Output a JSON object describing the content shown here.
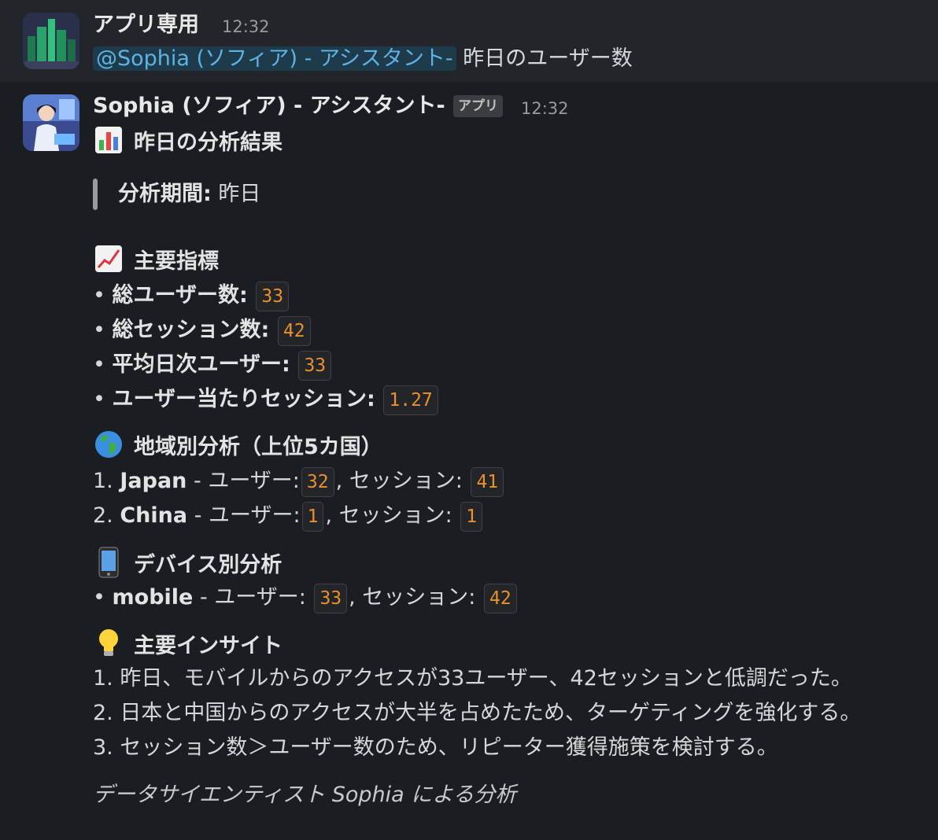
{
  "message1": {
    "sender": "アプリ専用",
    "time": "12:32",
    "mention": "@Sophia (ソフィア) - アシスタント-",
    "text": "昨日のユーザー数"
  },
  "message2": {
    "sender": "Sophia (ソフィア) - アシスタント-",
    "badge": "アプリ",
    "time": "12:32",
    "title_icon": "bar-chart-emoji",
    "title": "昨日の分析結果",
    "period_label": "分析期間:",
    "period_value": "昨日",
    "metrics": {
      "heading_icon": "chart-increasing-emoji",
      "heading": "主要指標",
      "items": [
        {
          "label": "総ユーザー数:",
          "value": "33"
        },
        {
          "label": "総セッション数:",
          "value": "42"
        },
        {
          "label": "平均日次ユーザー:",
          "value": "33"
        },
        {
          "label": "ユーザー当たりセッション:",
          "value": "1.27"
        }
      ]
    },
    "region": {
      "heading_icon": "globe-emoji",
      "heading": "地域別分析（上位5カ国）",
      "items": [
        {
          "prefix": "1.",
          "country": "Japan",
          "users_label": "- ユーザー:",
          "users": "32",
          "sessions_label": ", セッション:",
          "sessions": "41"
        },
        {
          "prefix": "2.",
          "country": "China",
          "users_label": "- ユーザー:",
          "users": "1",
          "sessions_label": ", セッション:",
          "sessions": "1"
        }
      ]
    },
    "device": {
      "heading_icon": "mobile-phone-emoji",
      "heading": "デバイス別分析",
      "items": [
        {
          "device": "mobile",
          "users_label": "- ユーザー:",
          "users": "33",
          "sessions_label": ", セッション:",
          "sessions": "42"
        }
      ]
    },
    "insights": {
      "heading_icon": "light-bulb-emoji",
      "heading": "主要インサイト",
      "items": [
        "1. 昨日、モバイルからのアクセスが33ユーザー、42セッションと低調だった。",
        "2. 日本と中国からのアクセスが大半を占めたため、ターゲティングを強化する。",
        "3. セッション数＞ユーザー数のため、リピーター獲得施策を検討する。"
      ]
    },
    "signature": "データサイエンティスト Sophia による分析"
  },
  "colors": {
    "background": "#1a1d21",
    "highlight_background": "#222529",
    "mention": "#5fb3e3",
    "code_value": "#e8912d"
  }
}
